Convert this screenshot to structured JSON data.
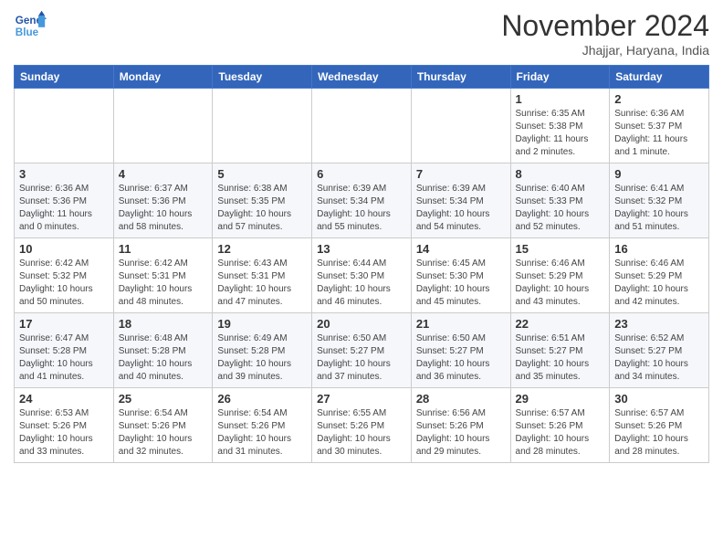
{
  "logo": {
    "line1": "General",
    "line2": "Blue"
  },
  "title": "November 2024",
  "subtitle": "Jhajjar, Haryana, India",
  "days_header": [
    "Sunday",
    "Monday",
    "Tuesday",
    "Wednesday",
    "Thursday",
    "Friday",
    "Saturday"
  ],
  "weeks": [
    [
      {
        "day": "",
        "info": ""
      },
      {
        "day": "",
        "info": ""
      },
      {
        "day": "",
        "info": ""
      },
      {
        "day": "",
        "info": ""
      },
      {
        "day": "",
        "info": ""
      },
      {
        "day": "1",
        "info": "Sunrise: 6:35 AM\nSunset: 5:38 PM\nDaylight: 11 hours\nand 2 minutes."
      },
      {
        "day": "2",
        "info": "Sunrise: 6:36 AM\nSunset: 5:37 PM\nDaylight: 11 hours\nand 1 minute."
      }
    ],
    [
      {
        "day": "3",
        "info": "Sunrise: 6:36 AM\nSunset: 5:36 PM\nDaylight: 11 hours\nand 0 minutes."
      },
      {
        "day": "4",
        "info": "Sunrise: 6:37 AM\nSunset: 5:36 PM\nDaylight: 10 hours\nand 58 minutes."
      },
      {
        "day": "5",
        "info": "Sunrise: 6:38 AM\nSunset: 5:35 PM\nDaylight: 10 hours\nand 57 minutes."
      },
      {
        "day": "6",
        "info": "Sunrise: 6:39 AM\nSunset: 5:34 PM\nDaylight: 10 hours\nand 55 minutes."
      },
      {
        "day": "7",
        "info": "Sunrise: 6:39 AM\nSunset: 5:34 PM\nDaylight: 10 hours\nand 54 minutes."
      },
      {
        "day": "8",
        "info": "Sunrise: 6:40 AM\nSunset: 5:33 PM\nDaylight: 10 hours\nand 52 minutes."
      },
      {
        "day": "9",
        "info": "Sunrise: 6:41 AM\nSunset: 5:32 PM\nDaylight: 10 hours\nand 51 minutes."
      }
    ],
    [
      {
        "day": "10",
        "info": "Sunrise: 6:42 AM\nSunset: 5:32 PM\nDaylight: 10 hours\nand 50 minutes."
      },
      {
        "day": "11",
        "info": "Sunrise: 6:42 AM\nSunset: 5:31 PM\nDaylight: 10 hours\nand 48 minutes."
      },
      {
        "day": "12",
        "info": "Sunrise: 6:43 AM\nSunset: 5:31 PM\nDaylight: 10 hours\nand 47 minutes."
      },
      {
        "day": "13",
        "info": "Sunrise: 6:44 AM\nSunset: 5:30 PM\nDaylight: 10 hours\nand 46 minutes."
      },
      {
        "day": "14",
        "info": "Sunrise: 6:45 AM\nSunset: 5:30 PM\nDaylight: 10 hours\nand 45 minutes."
      },
      {
        "day": "15",
        "info": "Sunrise: 6:46 AM\nSunset: 5:29 PM\nDaylight: 10 hours\nand 43 minutes."
      },
      {
        "day": "16",
        "info": "Sunrise: 6:46 AM\nSunset: 5:29 PM\nDaylight: 10 hours\nand 42 minutes."
      }
    ],
    [
      {
        "day": "17",
        "info": "Sunrise: 6:47 AM\nSunset: 5:28 PM\nDaylight: 10 hours\nand 41 minutes."
      },
      {
        "day": "18",
        "info": "Sunrise: 6:48 AM\nSunset: 5:28 PM\nDaylight: 10 hours\nand 40 minutes."
      },
      {
        "day": "19",
        "info": "Sunrise: 6:49 AM\nSunset: 5:28 PM\nDaylight: 10 hours\nand 39 minutes."
      },
      {
        "day": "20",
        "info": "Sunrise: 6:50 AM\nSunset: 5:27 PM\nDaylight: 10 hours\nand 37 minutes."
      },
      {
        "day": "21",
        "info": "Sunrise: 6:50 AM\nSunset: 5:27 PM\nDaylight: 10 hours\nand 36 minutes."
      },
      {
        "day": "22",
        "info": "Sunrise: 6:51 AM\nSunset: 5:27 PM\nDaylight: 10 hours\nand 35 minutes."
      },
      {
        "day": "23",
        "info": "Sunrise: 6:52 AM\nSunset: 5:27 PM\nDaylight: 10 hours\nand 34 minutes."
      }
    ],
    [
      {
        "day": "24",
        "info": "Sunrise: 6:53 AM\nSunset: 5:26 PM\nDaylight: 10 hours\nand 33 minutes."
      },
      {
        "day": "25",
        "info": "Sunrise: 6:54 AM\nSunset: 5:26 PM\nDaylight: 10 hours\nand 32 minutes."
      },
      {
        "day": "26",
        "info": "Sunrise: 6:54 AM\nSunset: 5:26 PM\nDaylight: 10 hours\nand 31 minutes."
      },
      {
        "day": "27",
        "info": "Sunrise: 6:55 AM\nSunset: 5:26 PM\nDaylight: 10 hours\nand 30 minutes."
      },
      {
        "day": "28",
        "info": "Sunrise: 6:56 AM\nSunset: 5:26 PM\nDaylight: 10 hours\nand 29 minutes."
      },
      {
        "day": "29",
        "info": "Sunrise: 6:57 AM\nSunset: 5:26 PM\nDaylight: 10 hours\nand 28 minutes."
      },
      {
        "day": "30",
        "info": "Sunrise: 6:57 AM\nSunset: 5:26 PM\nDaylight: 10 hours\nand 28 minutes."
      }
    ]
  ]
}
